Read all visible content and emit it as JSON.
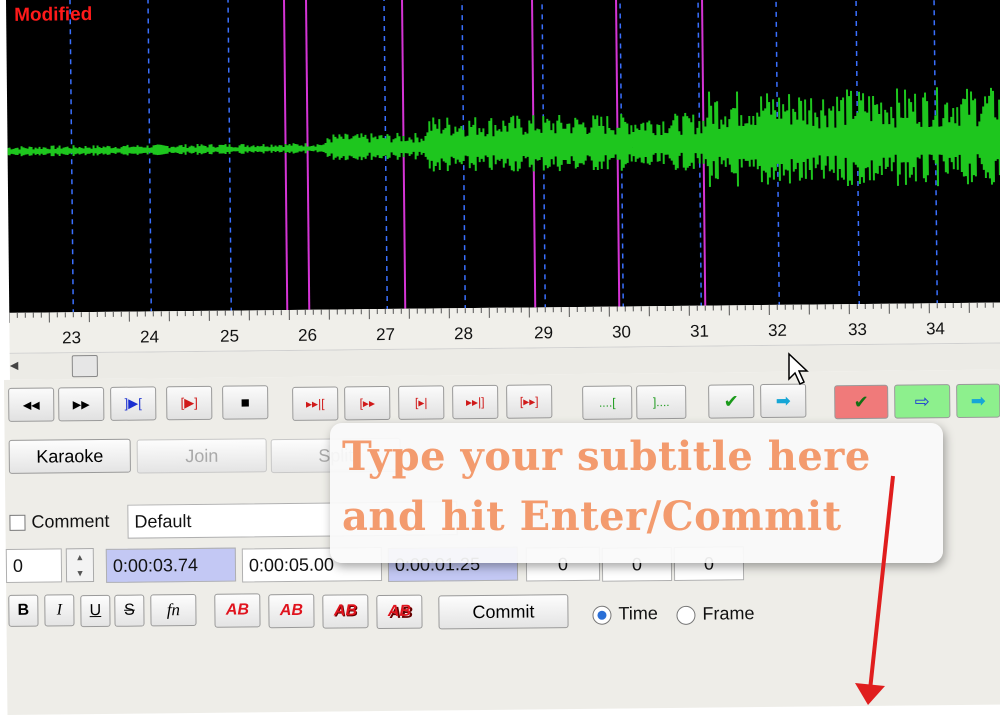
{
  "status": {
    "modified": "Modified"
  },
  "timeline": {
    "ticks": [
      "23",
      "24",
      "25",
      "26",
      "27",
      "28",
      "29",
      "30",
      "31",
      "32",
      "33",
      "34"
    ]
  },
  "toolbar": {
    "playback": [
      {
        "icon": "rewind-icon",
        "glyph": "◀◀"
      },
      {
        "icon": "fast-forward-icon",
        "glyph": "▶▶"
      },
      {
        "icon": "play-selection-icon",
        "glyph": "]▶["
      },
      {
        "icon": "play-range-icon",
        "glyph": "[▶]"
      },
      {
        "icon": "stop-icon",
        "glyph": "■"
      }
    ]
  },
  "buttons": {
    "karaoke": "Karaoke",
    "join": "Join",
    "split": "Split",
    "commit": "Commit"
  },
  "editor": {
    "comment_label": "Comment",
    "style_value": "Default",
    "layer_value": "0",
    "start_time": "0:00:03.74",
    "end_time": "0:00:05.00",
    "duration": "0:00:01.25",
    "margin_left": "0",
    "margin_right": "0",
    "margin_vertical": "0",
    "ab_label": "AB",
    "fn_label": "fn",
    "bold_label": "B",
    "italic_label": "I",
    "underline_label": "U",
    "strike_label": "S"
  },
  "mode": {
    "time_label": "Time",
    "frame_label": "Frame",
    "selected": "Time"
  },
  "annotation": {
    "line1": "Type your subtitle here",
    "line2": "and hit Enter/Commit"
  },
  "colors": {
    "wave": "#1ec61e",
    "keyframe": "#d534d5",
    "grid": "#3a70ff",
    "modified": "#ff1a1a",
    "annotation": "#f39b6e",
    "arrow": "#e01e1e"
  }
}
